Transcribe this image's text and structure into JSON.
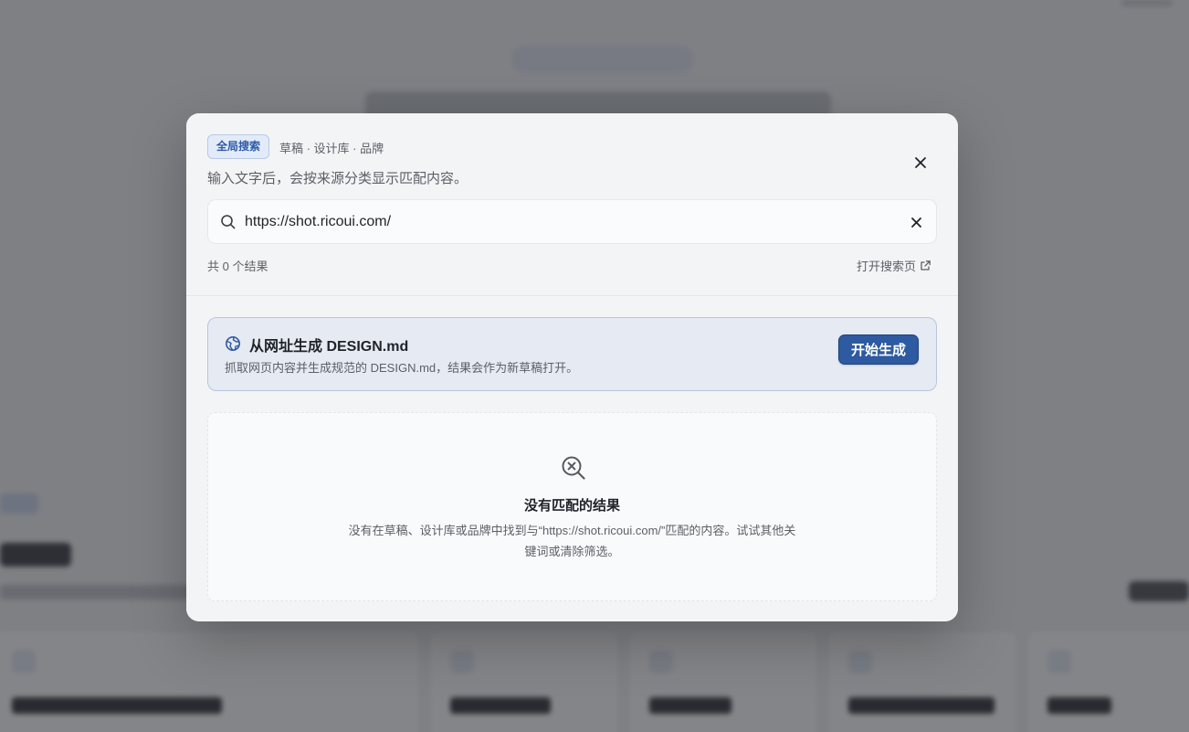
{
  "dialog": {
    "chip_label": "全局搜索",
    "scopes": "草稿 · 设计库 · 品牌",
    "subtitle": "输入文字后，会按来源分类显示匹配内容。",
    "close_icon": "close-icon"
  },
  "search": {
    "value": "https://shot.ricoui.com/",
    "icon": "search-icon",
    "clear_icon": "clear-icon"
  },
  "results": {
    "count_text": "共 0 个结果",
    "open_search_page": "打开搜索页",
    "open_icon": "external-link-icon"
  },
  "generate": {
    "icon": "globe-icon",
    "title": "从网址生成 DESIGN.md",
    "description": "抓取网页内容并生成规范的 DESIGN.md，结果会作为新草稿打开。",
    "button_label": "开始生成"
  },
  "empty_state": {
    "icon": "search-x-icon",
    "title": "没有匹配的结果",
    "description": "没有在草稿、设计库或品牌中找到与“https://shot.ricoui.com/”匹配的内容。试试其他关键词或清除筛选。"
  },
  "colors": {
    "accent": "#2d5aa0",
    "overlay": "#14161a"
  }
}
